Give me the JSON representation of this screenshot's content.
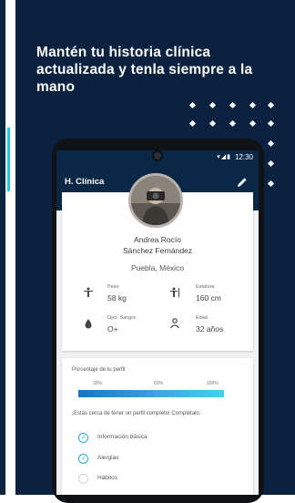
{
  "headline": "Mantén tu historia clínica actualizada y tenla siempre a la mano",
  "status_bar": {
    "time": "12:30",
    "icons": "▾◢▮"
  },
  "app": {
    "title": "H. Clínica"
  },
  "profile": {
    "name_line1": "Andrea Rocío",
    "name_line2": "Sánchez Fernández",
    "location": "Puebla, México",
    "stats": [
      {
        "label": "Peso",
        "value": "58 kg",
        "icon": "weight-icon"
      },
      {
        "label": "Estatura",
        "value": "160 cm",
        "icon": "height-icon"
      },
      {
        "label": "Gpo. Sangre",
        "value": "O+",
        "icon": "blood-drop-icon"
      },
      {
        "label": "Edad",
        "value": "32 años",
        "icon": "age-icon"
      }
    ]
  },
  "progress": {
    "title": "Porcentaje de tu perfil",
    "ticks": [
      "30%",
      "60%",
      "100%"
    ],
    "fill_fraction": 1.0,
    "prompt": "¡Estás cerca de tener un perfil completo! Completalo:"
  },
  "checklist": [
    {
      "label": "Información básica",
      "checked": true
    },
    {
      "label": "Alergias",
      "checked": true
    },
    {
      "label": "Hábitos",
      "checked": false
    }
  ],
  "colors": {
    "panel": "#0a2240",
    "accent": "#2aa8d8",
    "appbar": "#0b2746"
  }
}
